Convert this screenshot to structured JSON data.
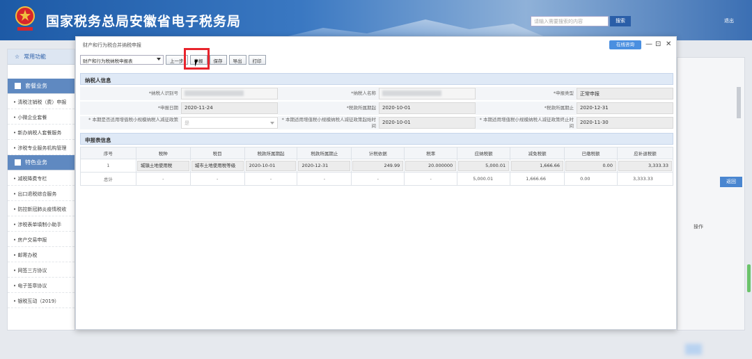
{
  "site": {
    "title": "国家税务总局安徽省电子税务局",
    "logo_text": "中国税务",
    "search_placeholder": "请输入需要搜索的内容",
    "search_button": "搜索",
    "header_link": "退出"
  },
  "sidebar": {
    "common_section": "常用功能",
    "hot_section": "套餐业务",
    "hot_items": [
      "清税注销税（费）申报",
      "小微企业套餐",
      "新办纳税人套餐服务",
      "涉税专业服务机构管理"
    ],
    "special_section": "特色业务",
    "special_items": [
      "减税降费专栏",
      "出口退税综合服务",
      "防控新冠肺炎疫情税收",
      "涉税表单填制小助手",
      "房产交易申报",
      "邮寄办税",
      "网签三方协议",
      "电子签章协议",
      "银税互动（2019）"
    ]
  },
  "background": {
    "return_button": "返回",
    "operation_header": "操作"
  },
  "modal": {
    "title": "财产和行为税合并纳税申报",
    "consult_button": "在线咨询",
    "minimize": "—",
    "maximize": "⊡",
    "close": "✕"
  },
  "toolbar": {
    "select_value": "财产和行为税纳税申报表",
    "prev_button": "上一步",
    "declare_button": "申报",
    "save_button": "保存",
    "export_button": "导出",
    "print_button": "打印"
  },
  "taxpayer_info": {
    "section_title": "纳税人信息",
    "id_label": "*纳税人识别号",
    "name_label": "*纳税人名称",
    "declare_type_label": "*申报类型",
    "declare_type_value": "正常申报",
    "declare_date_label": "*申报日期",
    "declare_date_value": "2020-11-24",
    "period_start_label": "*税款所属期起",
    "period_start_value": "2020-10-01",
    "period_end_label": "*税款所属期止",
    "period_end_value": "2020-12-31",
    "small_scale_label": "* 本期是否适用增值税小规模纳税人减征政策",
    "small_scale_value": "是",
    "reduce_start_label": "* 本期适用增值税小规模纳税人减征政策起始时间",
    "reduce_start_value": "2020-10-01",
    "reduce_end_label": "* 本期适用增值税小规模纳税人减征政策终止时间",
    "reduce_end_value": "2020-11-30"
  },
  "declaration_table": {
    "section_title": "申报表信息",
    "headers": [
      "序号",
      "税种",
      "税目",
      "税款所属期起",
      "税款所属期止",
      "计税依据",
      "税率",
      "应纳税额",
      "减免税额",
      "已缴税额",
      "应补退税额"
    ],
    "row": {
      "index": "1",
      "tax_type": "城镇土地使用税",
      "tax_item": "城市土地使用税等级",
      "start": "2020-10-01",
      "end": "2020-12-31",
      "base": "249.99",
      "rate": "20.000000",
      "payable": "5,000.01",
      "reduction": "1,666.66",
      "paid": "0.00",
      "refund": "3,333.33"
    },
    "total": {
      "label": "总计",
      "dash": "-",
      "payable": "5,000.01",
      "reduction": "1,666.66",
      "paid": "0.00",
      "refund": "3,333.33"
    }
  }
}
